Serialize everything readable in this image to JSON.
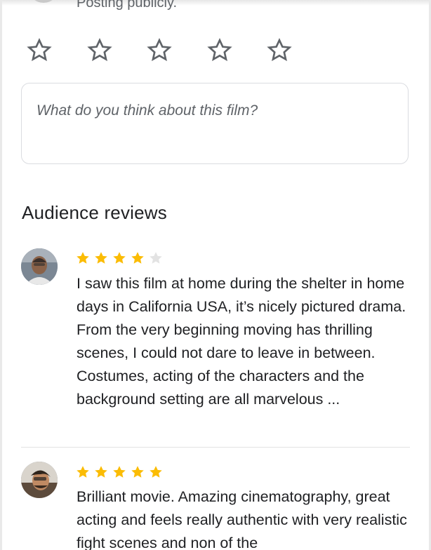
{
  "header": {
    "posting_label": "Posting publicly."
  },
  "rating_input": {
    "stars": [
      {
        "icon": "star-outline-icon"
      },
      {
        "icon": "star-outline-icon"
      },
      {
        "icon": "star-outline-icon"
      },
      {
        "icon": "star-outline-icon"
      },
      {
        "icon": "star-outline-icon"
      }
    ],
    "outline_color": "#5f6368"
  },
  "review_input": {
    "placeholder": "What do you think about this film?"
  },
  "audience": {
    "title": "Audience reviews",
    "star_color": "#fbbc04",
    "empty_star_color": "#dadce0",
    "reviews": [
      {
        "rating": 4,
        "max_rating": 5,
        "text": "I saw this film at home during the shelter in home days in California USA, it’s nicely pictured drama. From the very beginning moving has thrilling scenes, I could not dare to leave in between. Costumes, acting of the characters and the background setting are all marvelous ..."
      },
      {
        "rating": 5,
        "max_rating": 5,
        "text": "Brilliant movie. Amazing cinematography, great acting and feels really authentic with very realistic fight scenes and non of the"
      }
    ]
  }
}
